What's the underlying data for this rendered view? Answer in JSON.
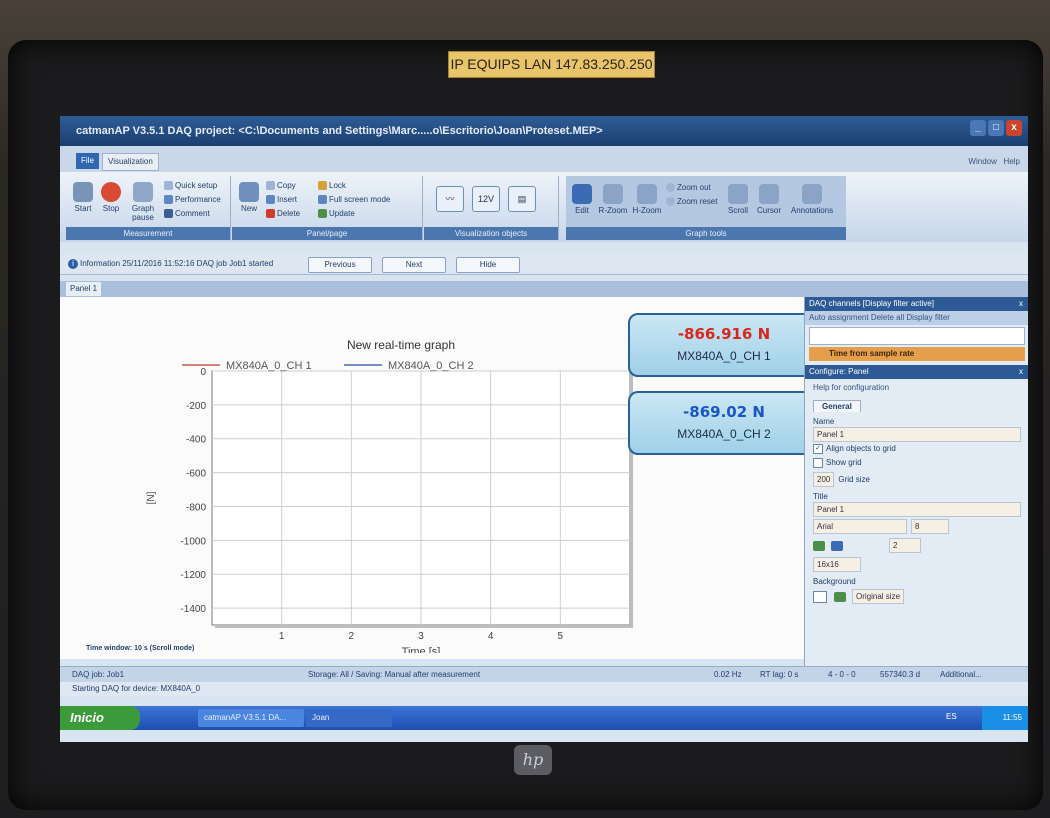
{
  "scene": {
    "ip_label": "IP EQUIPS LAN 147.83.250.250",
    "brand_logo": "hp"
  },
  "window": {
    "title": "catmanAP V3.5.1 DAQ project: <C:\\Documents and Settings\\Marc.....o\\Escritorio\\Joan\\Proteset.MEP>",
    "controls": [
      "_",
      "□",
      "x"
    ]
  },
  "ribbon_tabs": {
    "file": "File",
    "visualization": "Visualization"
  },
  "help_area": {
    "window": "Window",
    "help": "Help"
  },
  "ribbon": {
    "measurement": {
      "label": "Measurement",
      "start": "Start",
      "stop": "Stop",
      "graph_pause": "Graph pause",
      "quick_setup": "Quick setup",
      "performance": "Performance",
      "comment": "Comment"
    },
    "panelpage": {
      "label": "Panel/page",
      "new": "New",
      "copy": "Copy",
      "insert": "Insert",
      "delete": "Delete",
      "lock": "Lock",
      "full_screen": "Full screen mode",
      "update": "Update"
    },
    "visualization_objects": {
      "label": "Visualization objects",
      "digital_icon": "12V"
    },
    "graph_tools": {
      "label": "Graph tools",
      "edit": "Edit",
      "rzoom": "R-Zoom",
      "hzoom": "H-Zoom",
      "zoom_out": "Zoom out",
      "zoom_reset": "Zoom reset",
      "scroll": "Scroll",
      "cursor": "Cursor",
      "annotations": "Annotations"
    }
  },
  "infobar": {
    "text": "Information  25/11/2016 11:52:16 DAQ job Job1 started",
    "previous": "Previous",
    "next": "Next",
    "hide": "Hide"
  },
  "panel_tab": "Panel 1",
  "value_displays": [
    {
      "value": "-866.916 N",
      "channel": "MX840A_0_CH 1",
      "color": "#d8271c"
    },
    {
      "value": "-869.02 N",
      "channel": "MX840A_0_CH 2",
      "color": "#1a55c4"
    }
  ],
  "time_window": "Time window: 10 s (Scroll mode)",
  "chart_data": {
    "type": "line",
    "title": "New real-time graph",
    "xlabel": "Time [s]",
    "ylabel": "[N]",
    "xlim": [
      0,
      6
    ],
    "ylim": [
      -1500,
      0
    ],
    "x_ticks": [
      "1",
      "2",
      "3",
      "4",
      "5"
    ],
    "y_ticks": [
      "0",
      "-200",
      "-400",
      "-600",
      "-800",
      "-1000",
      "-1200",
      "-1400"
    ],
    "series": [
      {
        "name": "MX840A_0_CH 1",
        "color": "#c0392b",
        "values": []
      },
      {
        "name": "MX840A_0_CH 2",
        "color": "#2b4fa8",
        "values": []
      }
    ],
    "grid": true,
    "legend": "top"
  },
  "side_panel": {
    "daq_header": "DAQ channels [Display filter active]",
    "daq_toolbar": "Auto assignment  Delete all  Display filter",
    "daq_row": "Time from sample rate",
    "cfg_header": "Configure: Panel",
    "help_link": "Help for configuration",
    "general_tab": "General",
    "name_label": "Name",
    "name_value": "Panel 1",
    "align_grid": "Align objects to grid",
    "show_grid": "Show grid",
    "grid_size_value": "200",
    "grid_size_label": "Grid size",
    "title_label": "Title",
    "title_value": "Panel 1",
    "font": "Arial",
    "font_size": "8",
    "spin_value": "2",
    "icon_size": "16x16",
    "background_label": "Background",
    "original_size": "Original size"
  },
  "status": {
    "job": "DAQ job: Job1",
    "storage": "Storage: All / Saving: Manual after measurement",
    "rate": "0.02 Hz",
    "rt_lag": "RT lag: 0 s",
    "counts": "4 - 0 - 0",
    "time": "557340.3 d",
    "additional": "Additional...",
    "starting": "Starting DAQ for device: MX840A_0"
  },
  "taskbar": {
    "start": "Inicio",
    "task1": "catmanAP V3.5.1 DA...",
    "task2": "Joan",
    "lang": "ES",
    "clock": "11:55"
  }
}
